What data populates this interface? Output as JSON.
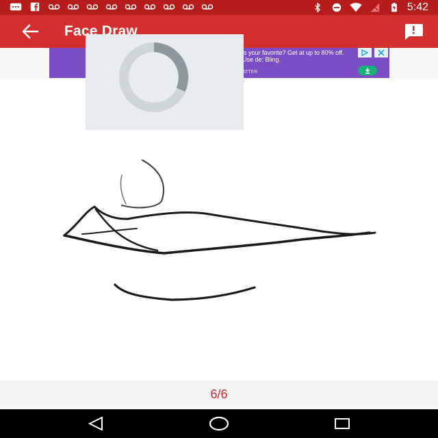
{
  "status_bar": {
    "time": "5:42",
    "left_icons": [
      "messages-icon",
      "facebook-icon",
      "voicemail-icon",
      "voicemail-icon",
      "voicemail-icon",
      "voicemail-icon",
      "voicemail-icon",
      "voicemail-icon",
      "voicemail-icon",
      "voicemail-icon",
      "voicemail-icon"
    ],
    "right_icons": [
      "bluetooth-icon",
      "do-not-disturb-icon",
      "wifi-icon",
      "no-signal-icon",
      "battery-charging-icon"
    ]
  },
  "app_bar": {
    "title": "Face Draw",
    "back_icon": "arrow-back-icon",
    "report_icon": "report-feedback-icon",
    "color": "#d32f2f"
  },
  "ad": {
    "text": "is your favorite? Get at up to 80% off. Use de: Bling.",
    "brand": "ATTER",
    "choices_icon": "ad-choices-icon",
    "close_icon": "close-icon",
    "download_icon": "download-icon",
    "background": "#7b4ec6"
  },
  "loading": {
    "spinner_icon": "loading-spinner-icon"
  },
  "drawing": {
    "subject": "lips-sketch"
  },
  "footer": {
    "page_counter": "6/6",
    "accent": "#c62828"
  },
  "nav_bar": {
    "back_icon": "nav-back-icon",
    "home_icon": "nav-home-icon",
    "recents_icon": "nav-recents-icon"
  }
}
